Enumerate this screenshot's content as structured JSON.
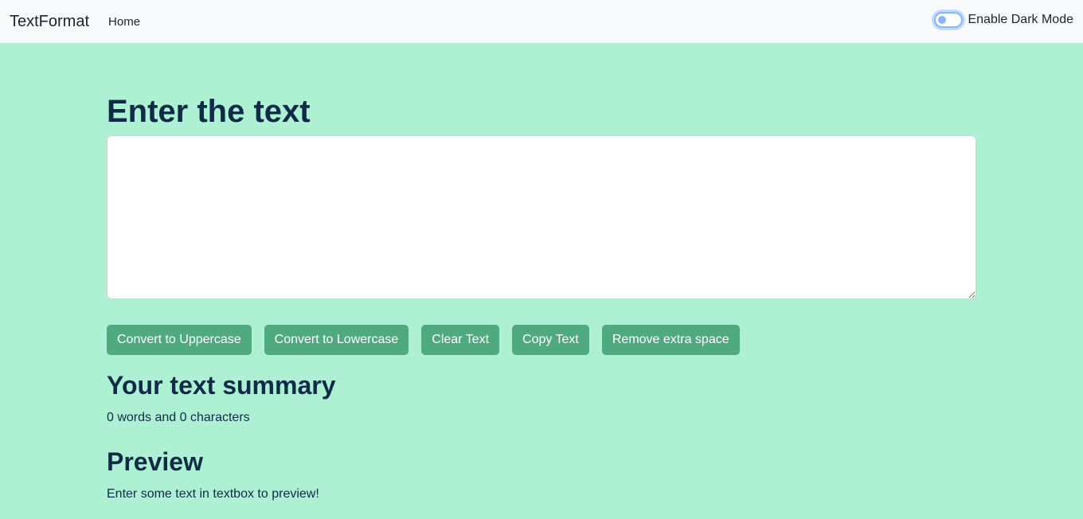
{
  "navbar": {
    "brand": "TextFormat",
    "links": [
      {
        "label": "Home"
      }
    ],
    "dark_mode_label": "Enable Dark Mode"
  },
  "main": {
    "heading": "Enter the text",
    "textarea_value": "",
    "buttons": [
      {
        "label": "Convert to Uppercase"
      },
      {
        "label": "Convert to Lowercase"
      },
      {
        "label": "Clear Text"
      },
      {
        "label": "Copy Text"
      },
      {
        "label": "Remove extra space"
      }
    ],
    "summary_heading": "Your text summary",
    "summary_text": "0 words and 0 characters",
    "preview_heading": "Preview",
    "preview_text": "Enter some text in textbox to preview!"
  },
  "colors": {
    "background": "#aef0d4",
    "button": "#4fab7f",
    "heading": "#0f2b45",
    "navbar": "#f8f9fa"
  },
  "state": {
    "dark_mode_enabled": false
  }
}
